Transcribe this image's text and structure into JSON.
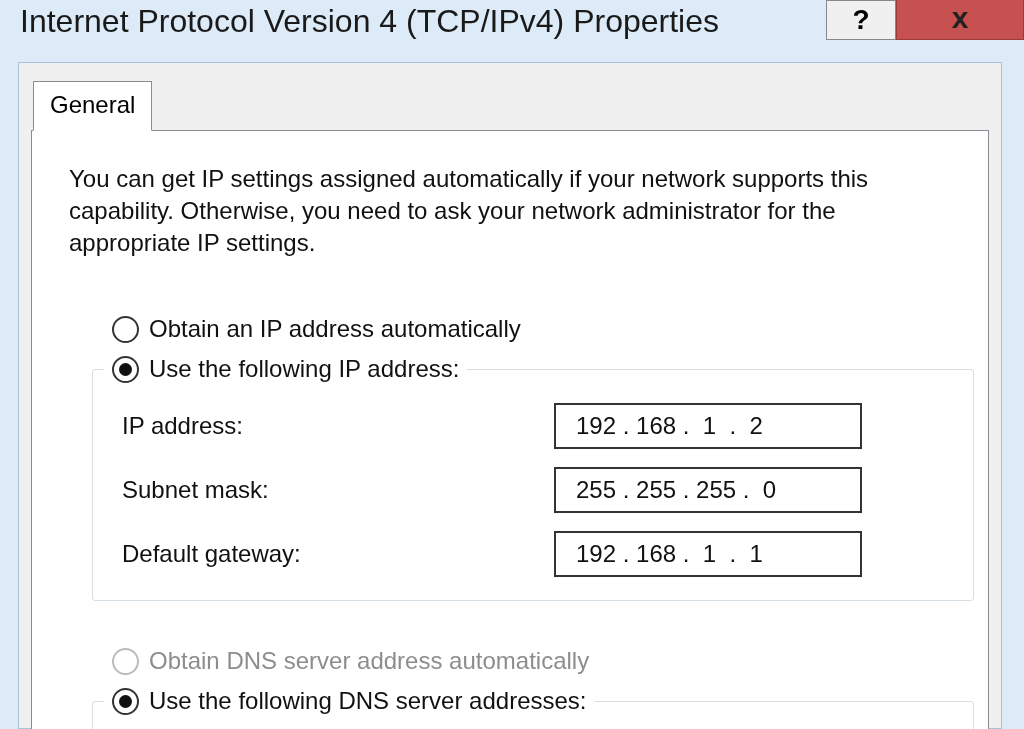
{
  "window": {
    "title": "Internet Protocol Version 4 (TCP/IPv4) Properties",
    "buttons": [
      {
        "kind": "help",
        "label": "?"
      },
      {
        "kind": "close",
        "label": "x"
      }
    ]
  },
  "tabs": [
    {
      "label": "General",
      "selected": true
    }
  ],
  "description": "You can get IP settings assigned automatically if your network supports this capability. Otherwise, you need to ask your network administrator for the appropriate IP settings.",
  "ip_options": [
    {
      "label": "Obtain an IP address automatically",
      "selected": false,
      "disabled": false
    },
    {
      "label": "Use the following IP address:",
      "selected": true,
      "disabled": false
    }
  ],
  "ip_fields": [
    {
      "label": "IP address:",
      "value": "192 . 168 .  1  .  2"
    },
    {
      "label": "Subnet mask:",
      "value": "255 . 255 . 255 .  0"
    },
    {
      "label": "Default gateway:",
      "value": "192 . 168 .  1  .  1"
    }
  ],
  "dns_options": [
    {
      "label": "Obtain DNS server address automatically",
      "selected": false,
      "disabled": true
    },
    {
      "label": "Use the following DNS server addresses:",
      "selected": true,
      "disabled": false
    }
  ]
}
